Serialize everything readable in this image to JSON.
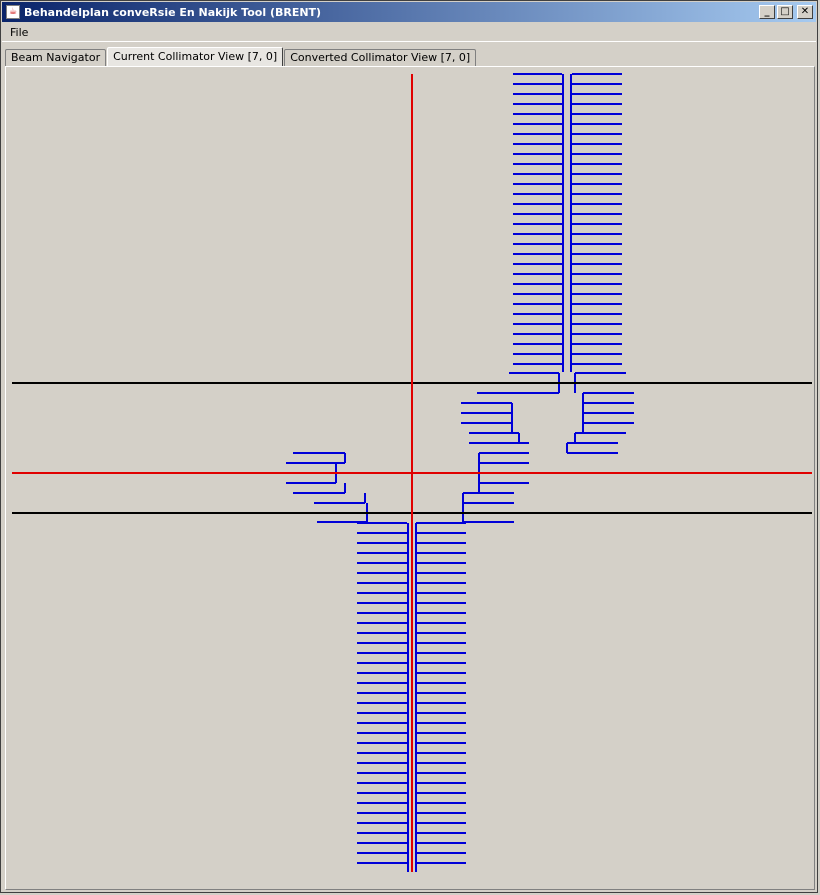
{
  "window": {
    "title": "Behandelplan conveRsie En Nakijk Tool (BRENT)",
    "buttons": {
      "minimize": "_",
      "maximize": "□",
      "close": "✕"
    }
  },
  "menu": {
    "items": [
      "File"
    ]
  },
  "tabs": [
    {
      "label": "Beam Navigator",
      "active": false
    },
    {
      "label": "Current Collimator View [7, 0]",
      "active": true
    },
    {
      "label": "Converted Collimator View [7, 0]",
      "active": false
    }
  ],
  "colors": {
    "leaf": "#0000d8",
    "crosshair": "#e00000",
    "jaw": "#000000",
    "background": "#d4d0c8"
  }
}
